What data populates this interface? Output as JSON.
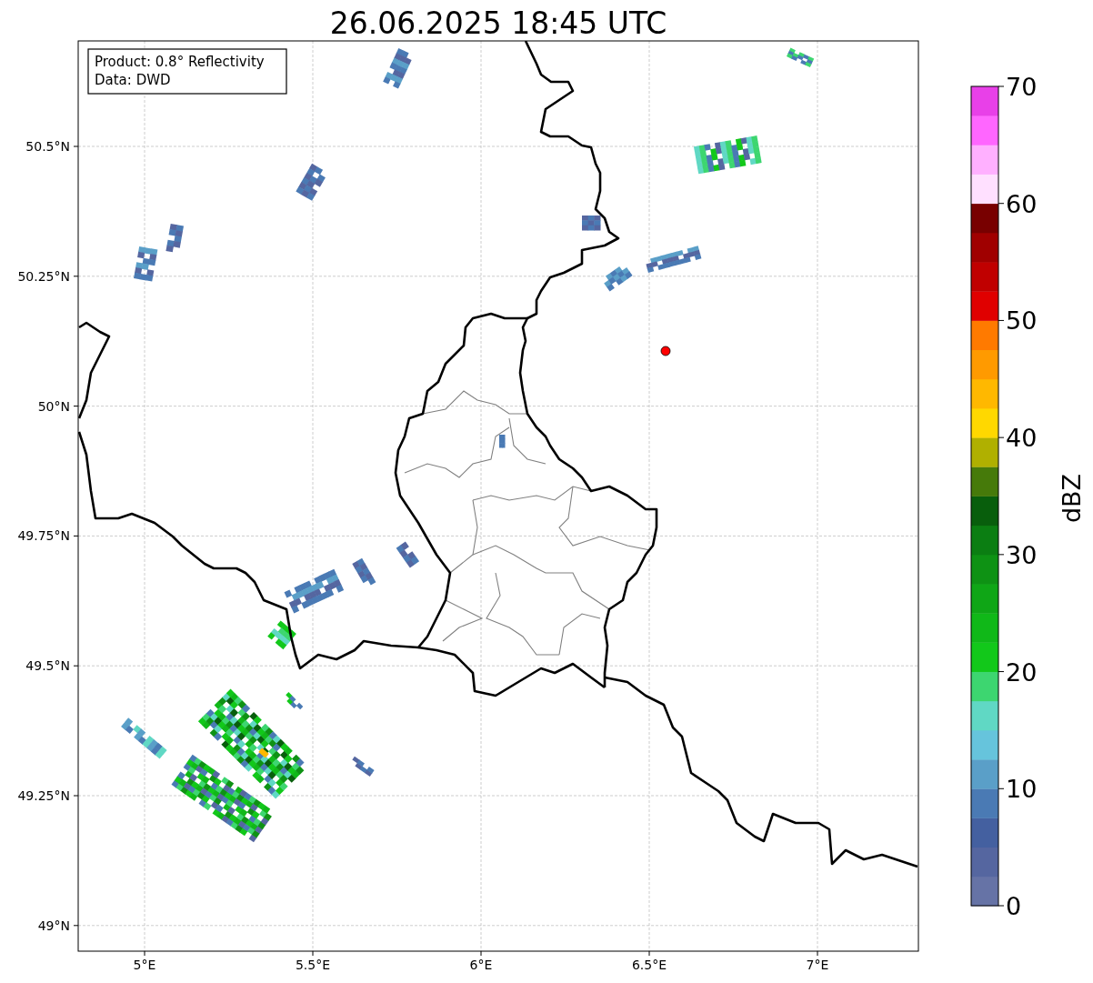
{
  "title": "26.06.2025 18:45 UTC",
  "info_box": {
    "lines": [
      "Product: 0.8° Reflectivity",
      "Data: DWD"
    ]
  },
  "map": {
    "lat_labels": [
      "50.5°N",
      "50.25°N",
      "50°N",
      "49.75°N",
      "49.5°N",
      "49.25°N",
      "49°N"
    ],
    "lon_labels": [
      "5°E",
      "5.5°E",
      "6°E",
      "6.5°E",
      "7°E"
    ]
  },
  "colorbar": {
    "label": "dBZ",
    "tick_labels": [
      "70",
      "60",
      "50",
      "40",
      "30",
      "20",
      "10",
      "0"
    ],
    "segments": [
      {
        "color": "#6673a6"
      },
      {
        "color": "#5566a0"
      },
      {
        "color": "#4460a0"
      },
      {
        "color": "#4a7ab4"
      },
      {
        "color": "#5a9fc8"
      },
      {
        "color": "#66c4dc"
      },
      {
        "color": "#60d8c4"
      },
      {
        "color": "#3dd670"
      },
      {
        "color": "#12c81a"
      },
      {
        "color": "#10b818"
      },
      {
        "color": "#0fa616"
      },
      {
        "color": "#0e9214"
      },
      {
        "color": "#0b7e12"
      },
      {
        "color": "#085e0c"
      },
      {
        "color": "#467a0a"
      },
      {
        "color": "#b0b000"
      },
      {
        "color": "#ffd800"
      },
      {
        "color": "#ffb800"
      },
      {
        "color": "#ff9a00"
      },
      {
        "color": "#ff7a00"
      },
      {
        "color": "#e00000"
      },
      {
        "color": "#c00000"
      },
      {
        "color": "#a00000"
      },
      {
        "color": "#780000"
      },
      {
        "color": "#ffe0ff"
      },
      {
        "color": "#ffb0ff"
      },
      {
        "color": "#ff66ff"
      },
      {
        "color": "#e840e8"
      }
    ]
  }
}
